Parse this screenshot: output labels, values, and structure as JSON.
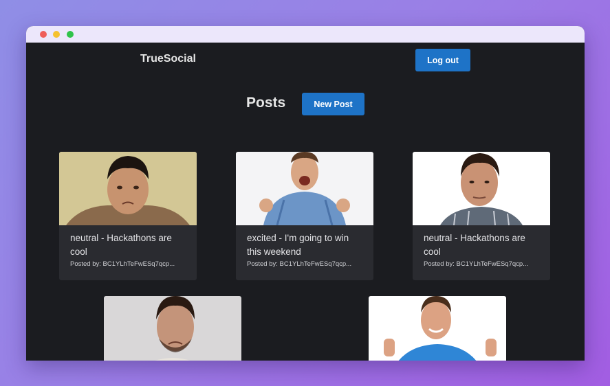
{
  "app": {
    "brand": "TrueSocial"
  },
  "header": {
    "logout_label": "Log out"
  },
  "page": {
    "title": "Posts",
    "new_post_label": "New Post"
  },
  "posts": [
    {
      "caption": "neutral - Hackathons are cool",
      "author": "Posted by: BC1YLhTeFwESq7qcp..."
    },
    {
      "caption": "excited - I'm going to win this weekend",
      "author": "Posted by: BC1YLhTeFwESq7qcp..."
    },
    {
      "caption": "neutral - Hackathons are cool",
      "author": "Posted by: BC1YLhTeFwESq7qcp..."
    },
    {
      "caption": "",
      "author": ""
    },
    {
      "caption": "",
      "author": ""
    }
  ],
  "colors": {
    "accent": "#1e73c7",
    "background": "#1b1c20",
    "card": "#2a2b30"
  }
}
